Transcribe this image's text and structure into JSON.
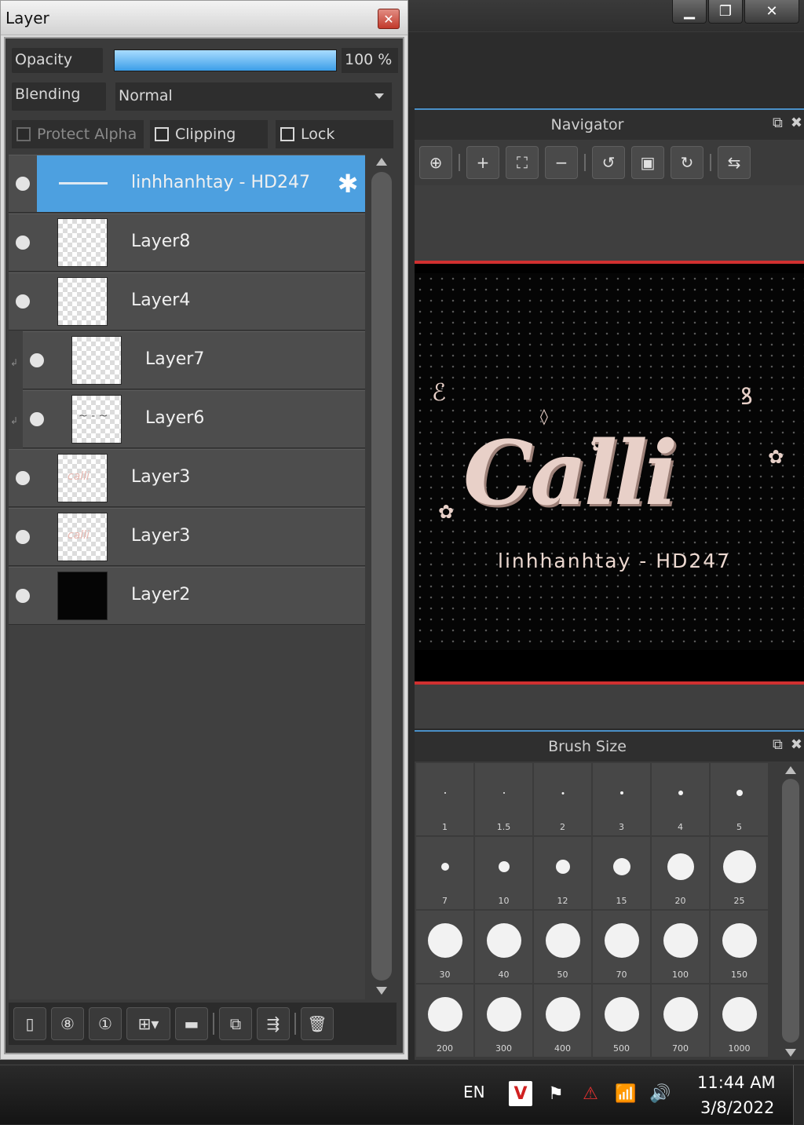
{
  "layer_panel": {
    "title": "Layer",
    "close_glyph": "✕",
    "opacity_label": "Opacity",
    "opacity_value": "100 %",
    "opacity_fraction": 1.0,
    "blending_label": "Blending",
    "blending_value": "Normal",
    "protect_alpha_label": "Protect Alpha",
    "clipping_label": "Clipping",
    "lock_label": "Lock",
    "layers": [
      {
        "name": "linhhanhtay - HD247",
        "thumb": "line",
        "selected": true
      },
      {
        "name": "Layer8",
        "thumb": "checker"
      },
      {
        "name": "Layer4",
        "thumb": "checker"
      },
      {
        "name": "Layer7",
        "thumb": "checker",
        "clipped": true
      },
      {
        "name": "Layer6",
        "thumb": "scribble",
        "clipped": true
      },
      {
        "name": "Layer3",
        "thumb": "pink"
      },
      {
        "name": "Layer3",
        "thumb": "pink"
      },
      {
        "name": "Layer2",
        "thumb": "black"
      }
    ],
    "toolbar_icons": [
      "new-layer-icon",
      "new-8bit-layer-icon",
      "new-1bit-layer-icon",
      "add-layer-dropdown-icon",
      "new-folder-icon",
      "duplicate-layer-icon",
      "merge-layer-icon",
      "delete-layer-icon"
    ]
  },
  "navigator": {
    "title": "Navigator",
    "toolbar_icons": [
      "zoom-reset-icon",
      "zoom-in-icon",
      "fit-window-icon",
      "zoom-out-icon",
      "rotate-left-icon",
      "fit-canvas-icon",
      "rotate-right-icon",
      "flip-horizontal-icon"
    ],
    "canvas_art_title": "Calli",
    "canvas_art_caption": "linhhanhtay - HD247"
  },
  "brush_size": {
    "title": "Brush Size",
    "sizes": [
      "1",
      "1.5",
      "2",
      "3",
      "4",
      "5",
      "7",
      "10",
      "12",
      "15",
      "20",
      "25",
      "30",
      "40",
      "50",
      "70",
      "100",
      "150",
      "200",
      "300",
      "400",
      "500",
      "700",
      "1000"
    ]
  },
  "window_controls": {
    "minimize": "▁",
    "maximize": "❐",
    "close": "✕"
  },
  "taskbar": {
    "language": "EN",
    "time": "11:44 AM",
    "date": "3/8/2022",
    "tray_v": "V"
  },
  "colors": {
    "selection_blue": "#4da0e0",
    "canvas_frame_red": "#d03030",
    "panel_dark": "#3b3b3b"
  }
}
